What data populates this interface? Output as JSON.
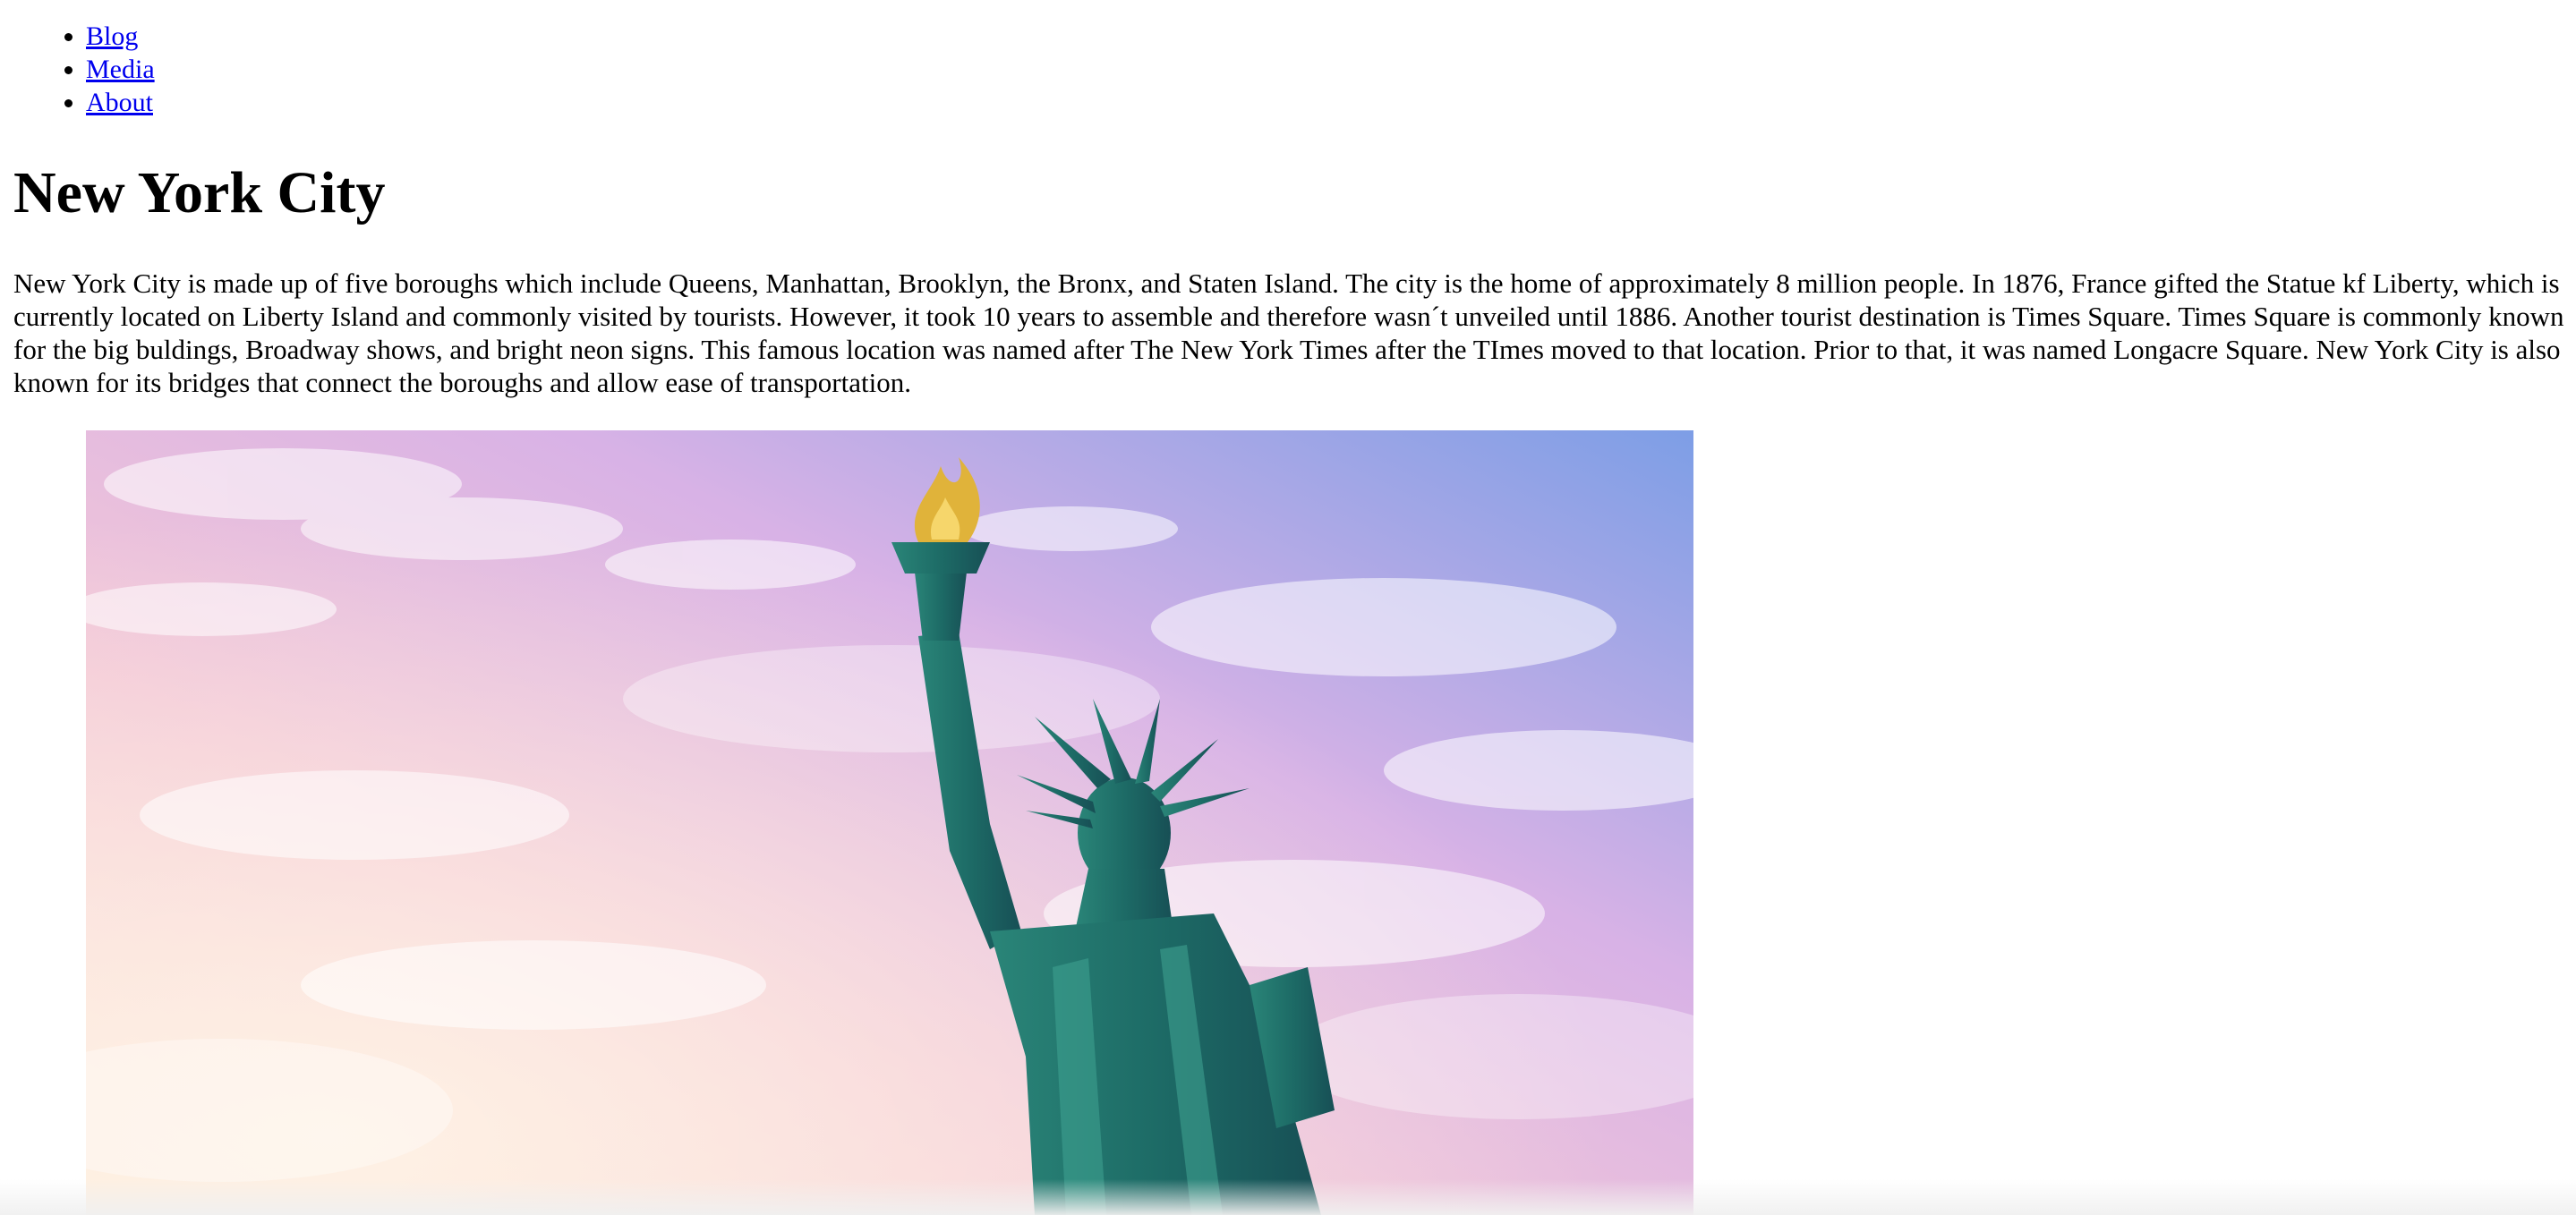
{
  "nav": {
    "items": [
      {
        "label": "Blog"
      },
      {
        "label": "Media"
      },
      {
        "label": "About"
      }
    ]
  },
  "main": {
    "title": "New York City",
    "paragraph": "New York City is made up of five boroughs which include Queens, Manhattan, Brooklyn, the Bronx, and Staten Island. The city is the home of approximately 8 million people. In 1876, France gifted the Statue kf Liberty, which is currently located on Liberty Island and commonly visited by tourists. However, it took 10 years to assemble and therefore wasn´t unveiled until 1886. Another tourist destination is Times Square. Times Square is commonly known for the big buldings, Broadway shows, and bright neon signs. This famous location was named after The New York Times after the TImes moved to that location. Prior to that, it was named Longacre Square. New York City is also known for its bridges that connect the boroughs and allow ease of transportation."
  },
  "colors": {
    "link": "#0000ee",
    "sky_top": "#7d9ee6",
    "sky_pink": "#f3c7d7",
    "sky_warm": "#fde6d8",
    "statue": "#1f6f68",
    "torch_flame": "#e0b33a"
  }
}
